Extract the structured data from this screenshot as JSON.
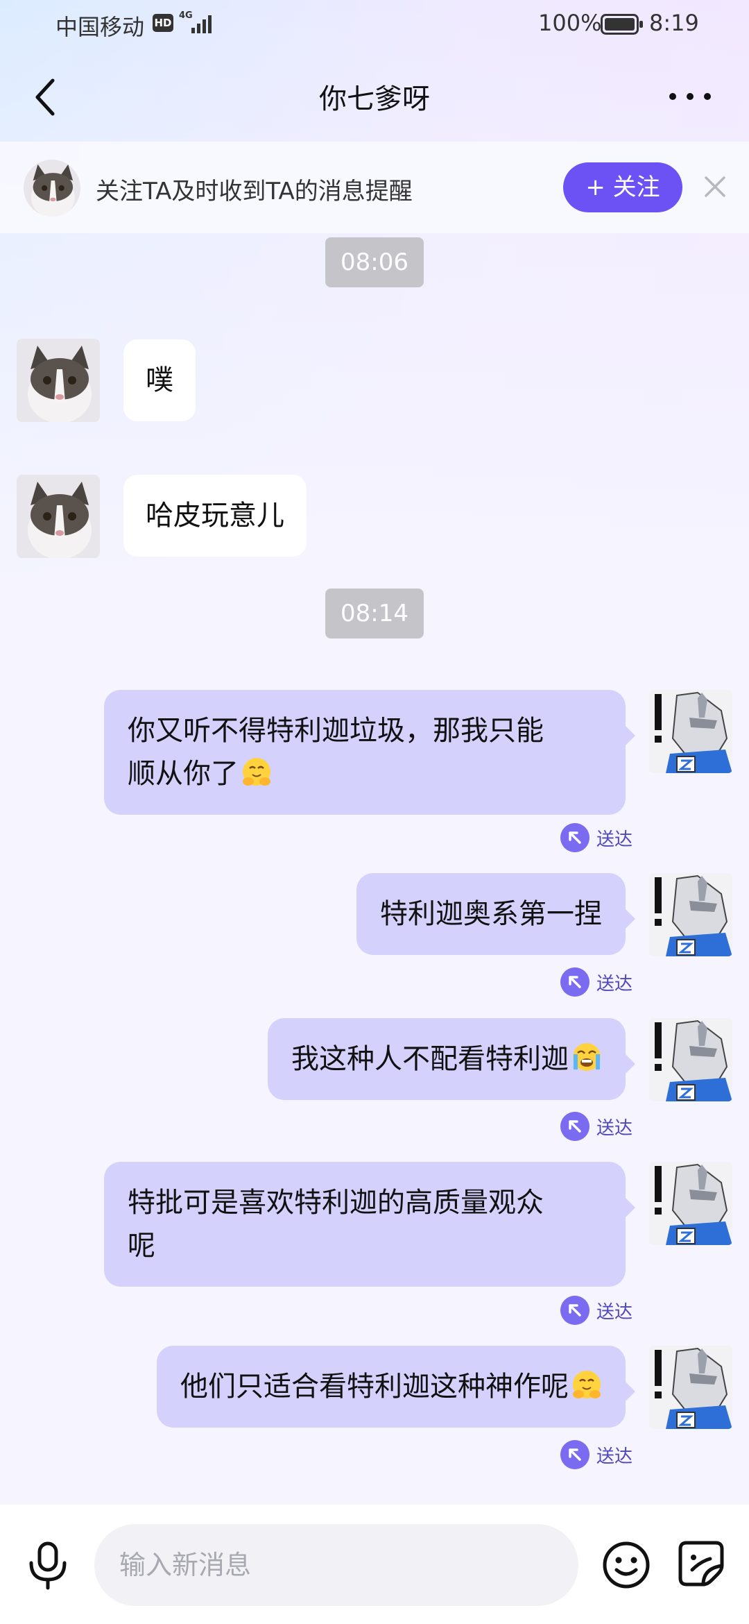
{
  "status_bar": {
    "carrier": "中国移动",
    "hd": "HD",
    "network": "4G",
    "battery": "100%",
    "time": "8:19"
  },
  "header": {
    "title": "你七爹呀"
  },
  "follow_banner": {
    "text": "关注TA及时收到TA的消息提醒",
    "button": "+ 关注"
  },
  "chat": {
    "timestamps": [
      "08:06",
      "08:14"
    ],
    "incoming": [
      {
        "text": "噗"
      },
      {
        "text": "哈皮玩意儿"
      }
    ],
    "outgoing": [
      {
        "line1": "你又听不得特利迦垃圾，那我只能",
        "line2": "顺从你了",
        "emoji": "pleading-hands-emoji",
        "status": "送达"
      },
      {
        "line1": "特利迦奥系第一捏",
        "status": "送达"
      },
      {
        "line1": "我这种人不配看特利迦",
        "emoji": "crying-emoji",
        "status": "送达"
      },
      {
        "line1": "特批可是喜欢特利迦的高质量观众",
        "line2": "呢",
        "status": "送达"
      },
      {
        "line1": "他们只适合看特利迦这种神作呢",
        "emoji": "pleading-hands-emoji",
        "status": "送达"
      }
    ]
  },
  "input_bar": {
    "placeholder": "输入新消息"
  },
  "colors": {
    "accent": "#6c52f5",
    "outgoing_bubble": "#d4d2fd",
    "incoming_bubble": "#ffffff",
    "timestamp_bg": "#c4c4c9"
  }
}
